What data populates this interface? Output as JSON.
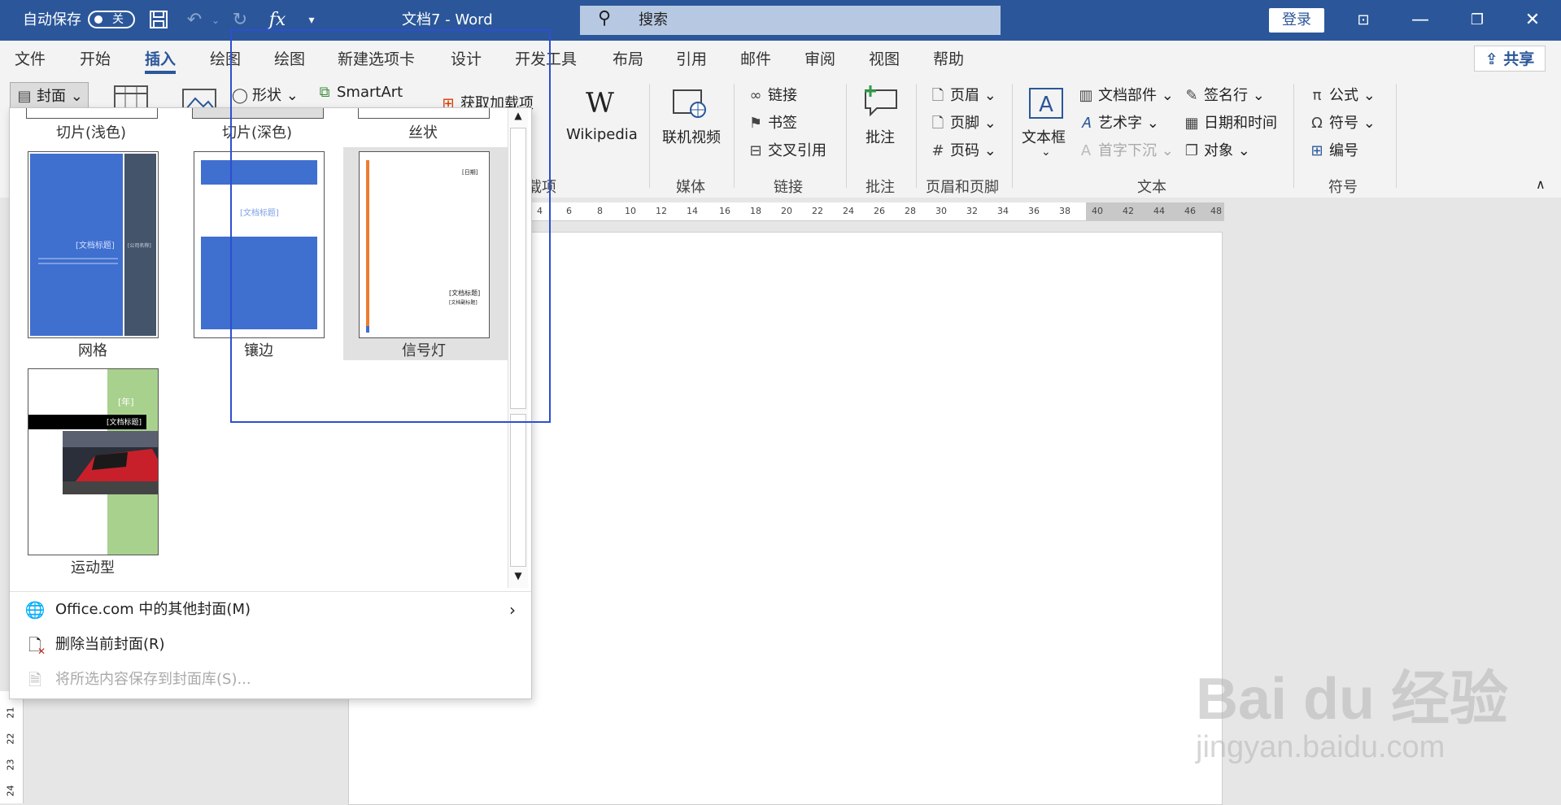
{
  "titlebar": {
    "autosave_label": "自动保存",
    "autosave_state": "关",
    "doc_title": "文档7  -  Word",
    "search_placeholder": "搜索",
    "login_label": "登录",
    "fx_label": "fx"
  },
  "tabs": [
    {
      "label": "文件"
    },
    {
      "label": "开始"
    },
    {
      "label": "插入",
      "active": true
    },
    {
      "label": "绘图"
    },
    {
      "label": "绘图"
    },
    {
      "label": "新建选项卡"
    },
    {
      "label": "设计"
    },
    {
      "label": "开发工具"
    },
    {
      "label": "布局"
    },
    {
      "label": "引用"
    },
    {
      "label": "邮件"
    },
    {
      "label": "审阅"
    },
    {
      "label": "视图"
    },
    {
      "label": "帮助"
    }
  ],
  "share_label": "共享",
  "ribbon": {
    "cover": "封面",
    "shapes": "形状",
    "smartart": "SmartArt",
    "get_addins": "获取加载项",
    "addins_group_partial": "载项",
    "wikipedia": "Wikipedia",
    "online_video": "联机视频",
    "media_group": "媒体",
    "link": "链接",
    "bookmark": "书签",
    "cross_ref": "交叉引用",
    "links_group": "链接",
    "comment": "批注",
    "comment_group": "批注",
    "header": "页眉",
    "footer": "页脚",
    "page_number": "页码",
    "header_footer_group": "页眉和页脚",
    "textbox": "文本框",
    "quick_parts": "文档部件",
    "wordart": "艺术字",
    "dropcap": "首字下沉",
    "signature": "签名行",
    "datetime": "日期和时间",
    "object": "对象",
    "text_group": "文本",
    "equation": "公式",
    "symbol": "符号",
    "numbering": "编号",
    "symbols_group": "符号"
  },
  "gallery": {
    "top_labels": [
      "切片(浅色)",
      "切片(深色)",
      "丝状"
    ],
    "items": [
      {
        "label": "网格",
        "title": "[文档标题]",
        "side": "[公司名称]"
      },
      {
        "label": "镶边",
        "title": "[文档标题]"
      },
      {
        "label": "信号灯",
        "date": "[日期]",
        "title": "[文档标题]",
        "subtitle": "[文档副标题]"
      },
      {
        "label": "运动型",
        "year": "[年]",
        "title": "[文档标题]"
      }
    ]
  },
  "menu": {
    "more_covers": "Office.com 中的其他封面(M)",
    "remove_cover": "删除当前封面(R)",
    "save_selection": "将所选内容保存到封面库(S)..."
  },
  "ruler_ticks": [
    "4",
    "6",
    "8",
    "10",
    "12",
    "14",
    "16",
    "18",
    "20",
    "22",
    "24",
    "26",
    "28",
    "30",
    "32",
    "34",
    "36",
    "38",
    "40",
    "42",
    "44",
    "46",
    "48"
  ],
  "vruler_ticks": [
    "21",
    "22",
    "23",
    "24"
  ],
  "watermark": {
    "brand": "Bai du 经验",
    "url": "jingyan.baidu.com"
  },
  "colors": {
    "word_blue": "#2b579a",
    "grid_blue": "#3f6fcf",
    "grid_dark": "#44546a",
    "sport_green": "#a9d18e",
    "signal_orange": "#ed7d31",
    "highlight_box": "#2d4fcf"
  }
}
